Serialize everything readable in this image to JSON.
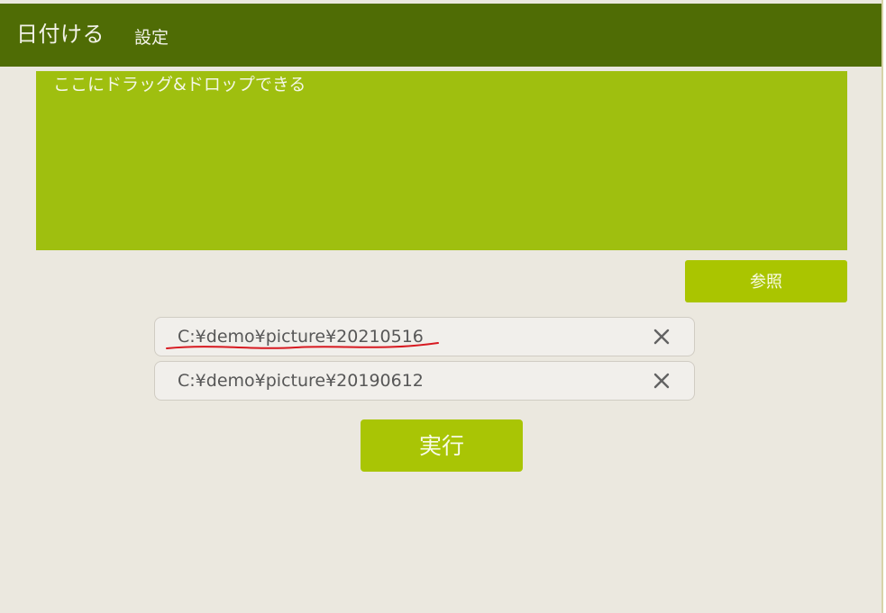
{
  "header": {
    "app_title": "日付ける",
    "settings_label": "設定"
  },
  "dropzone": {
    "label": "ここにドラッグ&ドロップできる"
  },
  "buttons": {
    "browse_label": "参照",
    "run_label": "実行"
  },
  "file_list": [
    {
      "path": "C:¥demo¥picture¥20210516",
      "remove_icon": "close-icon",
      "annotation": "red-underline"
    },
    {
      "path": "C:¥demo¥picture¥20190612",
      "remove_icon": "close-icon"
    }
  ],
  "colors": {
    "header": "#4f6c05",
    "dropzone": "#9fbf0f",
    "button": "#aac500",
    "background": "#ebe8df",
    "annotation": "#d71920"
  }
}
